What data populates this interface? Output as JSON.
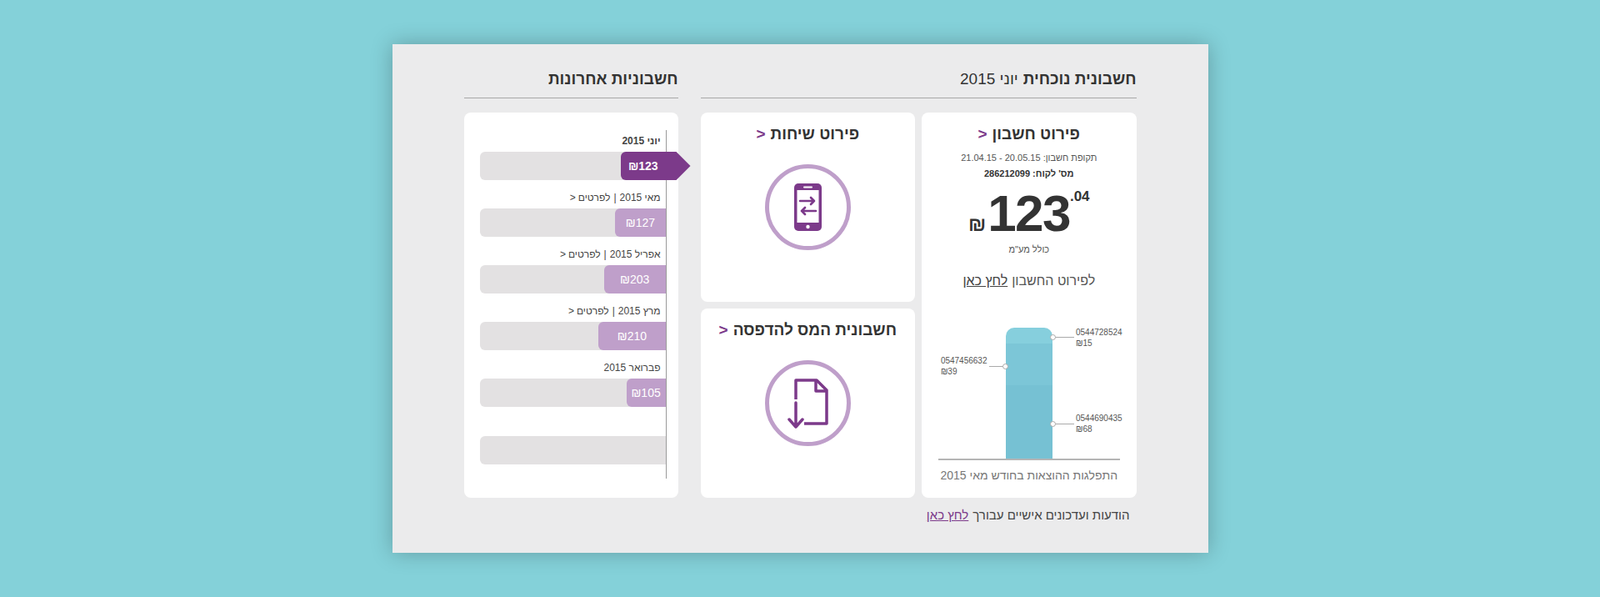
{
  "current": {
    "title": "חשבונית נוכחית",
    "month": "יוני 2015"
  },
  "bill": {
    "title": "פירוט חשבון",
    "chevron": ">",
    "period": "תקופת חשבון: 20.05.15 - 21.04.15",
    "customer": "מס' לקוח: 286212099",
    "currency": "₪",
    "amount_integer": "123",
    "amount_decimal": ".04",
    "vat_note": "כולל מע\"מ",
    "details_text": "לפירוט החשבון",
    "details_link": "לחץ כאן"
  },
  "chart": {
    "caption": "התפלגות ההוצאות בחודש מאי 2015",
    "segments": [
      {
        "phone": "0544728524",
        "amount": "₪15",
        "value": 15,
        "color": "#86cfdd"
      },
      {
        "phone": "0547456632",
        "amount": "₪39",
        "value": 39,
        "color": "#7cc6d7"
      },
      {
        "phone": "0544690435",
        "amount": "₪68",
        "value": 68,
        "color": "#76c1d3"
      }
    ]
  },
  "shortcuts": [
    {
      "title": "פירוט שיחות",
      "chevron": ">",
      "kind": "calls"
    },
    {
      "title": "חשבונית המס להדפסה",
      "chevron": ">",
      "kind": "invoice"
    }
  ],
  "history": {
    "title": "חשבוניות אחרונות",
    "separator": "|",
    "details_label": "לפרטים",
    "chevron": ">",
    "empty_slots": 1,
    "items": [
      {
        "month": "יוני 2015",
        "amount": "₪123",
        "level": 0.24,
        "selected": true,
        "details": false
      },
      {
        "month": "מאי 2015",
        "amount": "₪127",
        "level": 0.27,
        "selected": false,
        "details": true
      },
      {
        "month": "אפריל 2015",
        "amount": "₪203",
        "level": 0.33,
        "selected": false,
        "details": true
      },
      {
        "month": "מרץ 2015",
        "amount": "₪210",
        "level": 0.36,
        "selected": false,
        "details": true
      },
      {
        "month": "פברואר 2015",
        "amount": "₪105",
        "level": 0.21,
        "selected": false,
        "details": false
      }
    ]
  },
  "footer": {
    "text": "הודעות ועדכונים אישיים עבורך",
    "link": "לחץ כאן"
  }
}
